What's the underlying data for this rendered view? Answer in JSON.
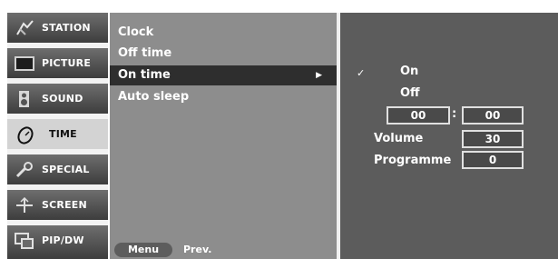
{
  "left_menu": {
    "items": [
      {
        "label": "STATION",
        "icon": "antenna-icon"
      },
      {
        "label": "PICTURE",
        "icon": "picture-icon"
      },
      {
        "label": "SOUND",
        "icon": "speaker-icon"
      },
      {
        "label": "TIME",
        "icon": "clock-icon"
      },
      {
        "label": "SPECIAL",
        "icon": "tools-icon"
      },
      {
        "label": "SCREEN",
        "icon": "screen-adjust-icon"
      },
      {
        "label": "PIP/DW",
        "icon": "pip-icon"
      }
    ],
    "selected": "TIME"
  },
  "submenu": {
    "items": [
      {
        "label": "Clock"
      },
      {
        "label": "Off time"
      },
      {
        "label": "On time",
        "arrow": "▶"
      },
      {
        "label": "Auto sleep"
      }
    ],
    "highlighted": "On time"
  },
  "footer": {
    "menu_label": "Menu",
    "prev_label": "Prev."
  },
  "settings": {
    "check_mark": "✓",
    "on_label": "On",
    "off_label": "Off",
    "hour_value": "00",
    "colon": ":",
    "minute_value": "00",
    "volume_label": "Volume",
    "volume_value": "30",
    "programme_label": "Programme",
    "programme_value": "0"
  },
  "colors": {
    "panel_bg": "#8d8d8d",
    "settings_bg": "#5c5c5c",
    "highlight_bg": "#2e2e2e",
    "selected_menu_bg": "#d3d3d3"
  }
}
